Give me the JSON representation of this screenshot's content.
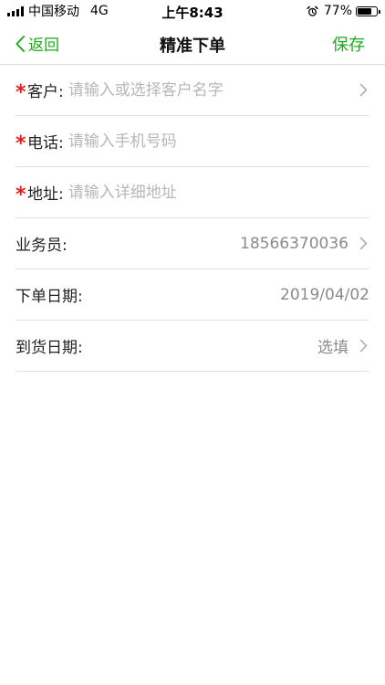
{
  "status_bar": {
    "carrier": "中国移动",
    "network": "4G",
    "time": "上午8:43",
    "battery": "77%",
    "battery_level": 0.77
  },
  "nav": {
    "back_label": "返回",
    "title": "精准下单",
    "save_label": "保存"
  },
  "form": {
    "customer": {
      "label": "客户:",
      "placeholder": "请输入或选择客户名字",
      "value": ""
    },
    "phone": {
      "label": "电话:",
      "placeholder": "请输入手机号码",
      "value": ""
    },
    "address": {
      "label": "地址:",
      "placeholder": "请输入详细地址",
      "value": ""
    },
    "salesperson": {
      "label": "业务员:",
      "value": "18566370036"
    },
    "order_date": {
      "label": "下单日期:",
      "value": "2019/04/02"
    },
    "arrival_date": {
      "label": "到货日期:",
      "value": "选填"
    }
  },
  "required_mark": "*",
  "colors": {
    "accent": "#1aad19",
    "required": "#e02020",
    "placeholder": "#b7b7b7",
    "value": "#8a8a8a",
    "divider": "#e2e2e2"
  },
  "icons": {
    "back": "chevron-left-icon",
    "row_arrow": "chevron-right-icon",
    "alarm": "alarm-clock-icon",
    "signal": "cellular-signal-icon",
    "battery": "battery-icon"
  }
}
